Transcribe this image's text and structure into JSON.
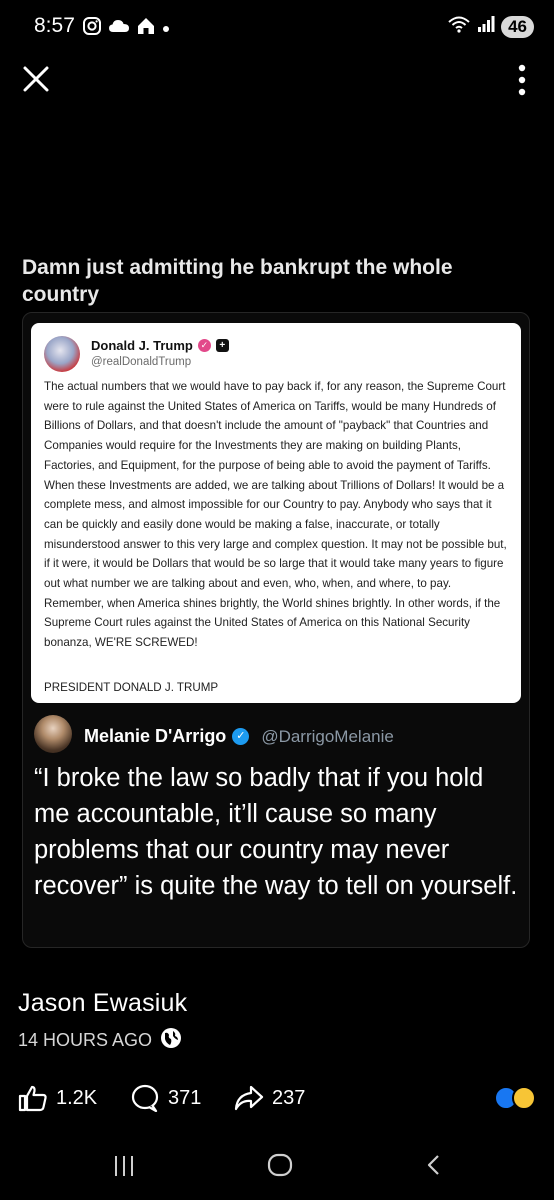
{
  "status_bar": {
    "time": "8:57",
    "battery": "46"
  },
  "post": {
    "caption": "Damn just admitting he bankrupt the whole country",
    "author": "Jason Ewasiuk",
    "time_ago": "14 HOURS AGO"
  },
  "truth_post": {
    "name": "Donald J. Trump",
    "handle": "@realDonaldTrump",
    "body": "The actual numbers that we would have to pay back if, for any reason, the Supreme Court were to rule against the United States of America on Tariffs, would be many Hundreds of Billions of Dollars, and that doesn't include the amount of \"payback\" that Countries and Companies would require for the Investments they are making on building Plants, Factories, and Equipment, for the purpose of being able to avoid the payment of Tariffs. When these Investments are added, we are talking about Trillions of Dollars! It would be a complete mess, and almost impossible for our Country to pay. Anybody who says that it can be quickly and easily done would be making a false, inaccurate, or totally misunderstood answer to this very large and complex question. It may not be possible but, if it were, it would be Dollars that would be so large that it would take many years to figure out what number we are talking about and even, who, when, and where, to pay. Remember, when America shines brightly, the World shines brightly. In other words, if the Supreme Court rules against the United States of America on this National Security bonanza, WE'RE SCREWED!",
    "signature": "PRESIDENT DONALD J. TRUMP"
  },
  "tweet": {
    "name": "Melanie D'Arrigo",
    "handle": "@DarrigoMelanie",
    "text": "“I broke the law so badly that if you hold me accountable, it’ll cause so many problems that our country may never recover” is quite the way to tell on yourself."
  },
  "reactions": {
    "likes": "1.2K",
    "comments": "371",
    "shares": "237"
  },
  "colors": {
    "background": "#000000",
    "verified_blue": "#1d9bf0",
    "truth_badge": "#e2498a"
  }
}
